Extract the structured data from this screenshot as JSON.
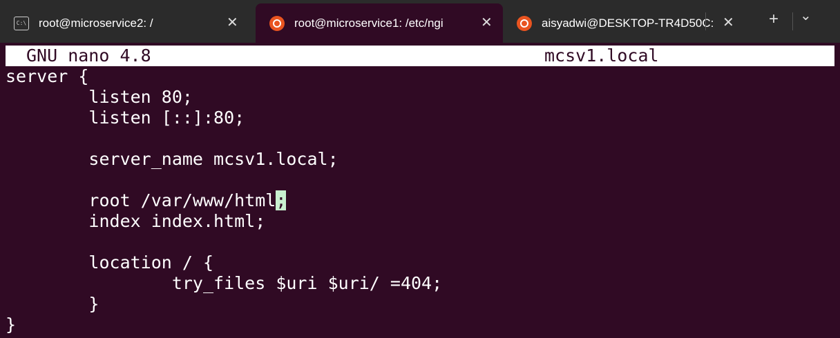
{
  "tabs": [
    {
      "title": "root@microservice2: /",
      "icon": "cmd-icon",
      "active": false
    },
    {
      "title": "root@microservice1: /etc/ngi",
      "icon": "ubuntu-icon",
      "active": true
    },
    {
      "title": "aisyadwi@DESKTOP-TR4D50C:",
      "icon": "ubuntu-icon",
      "active": false
    }
  ],
  "tab_close_glyph": "✕",
  "new_tab_glyph": "+",
  "dropdown_glyph": "⌄",
  "nano": {
    "version_label": "GNU nano 4.8",
    "filename": "mcsv1.local"
  },
  "lines": [
    "server {",
    "        listen 80;",
    "        listen [::]:80;",
    "",
    "        server_name mcsv1.local;",
    "",
    "        root /var/www/html",
    "        index index.html;",
    "",
    "        location / {",
    "                try_files $uri $uri/ =404;",
    "        }",
    "}"
  ],
  "cursor_char": ";"
}
